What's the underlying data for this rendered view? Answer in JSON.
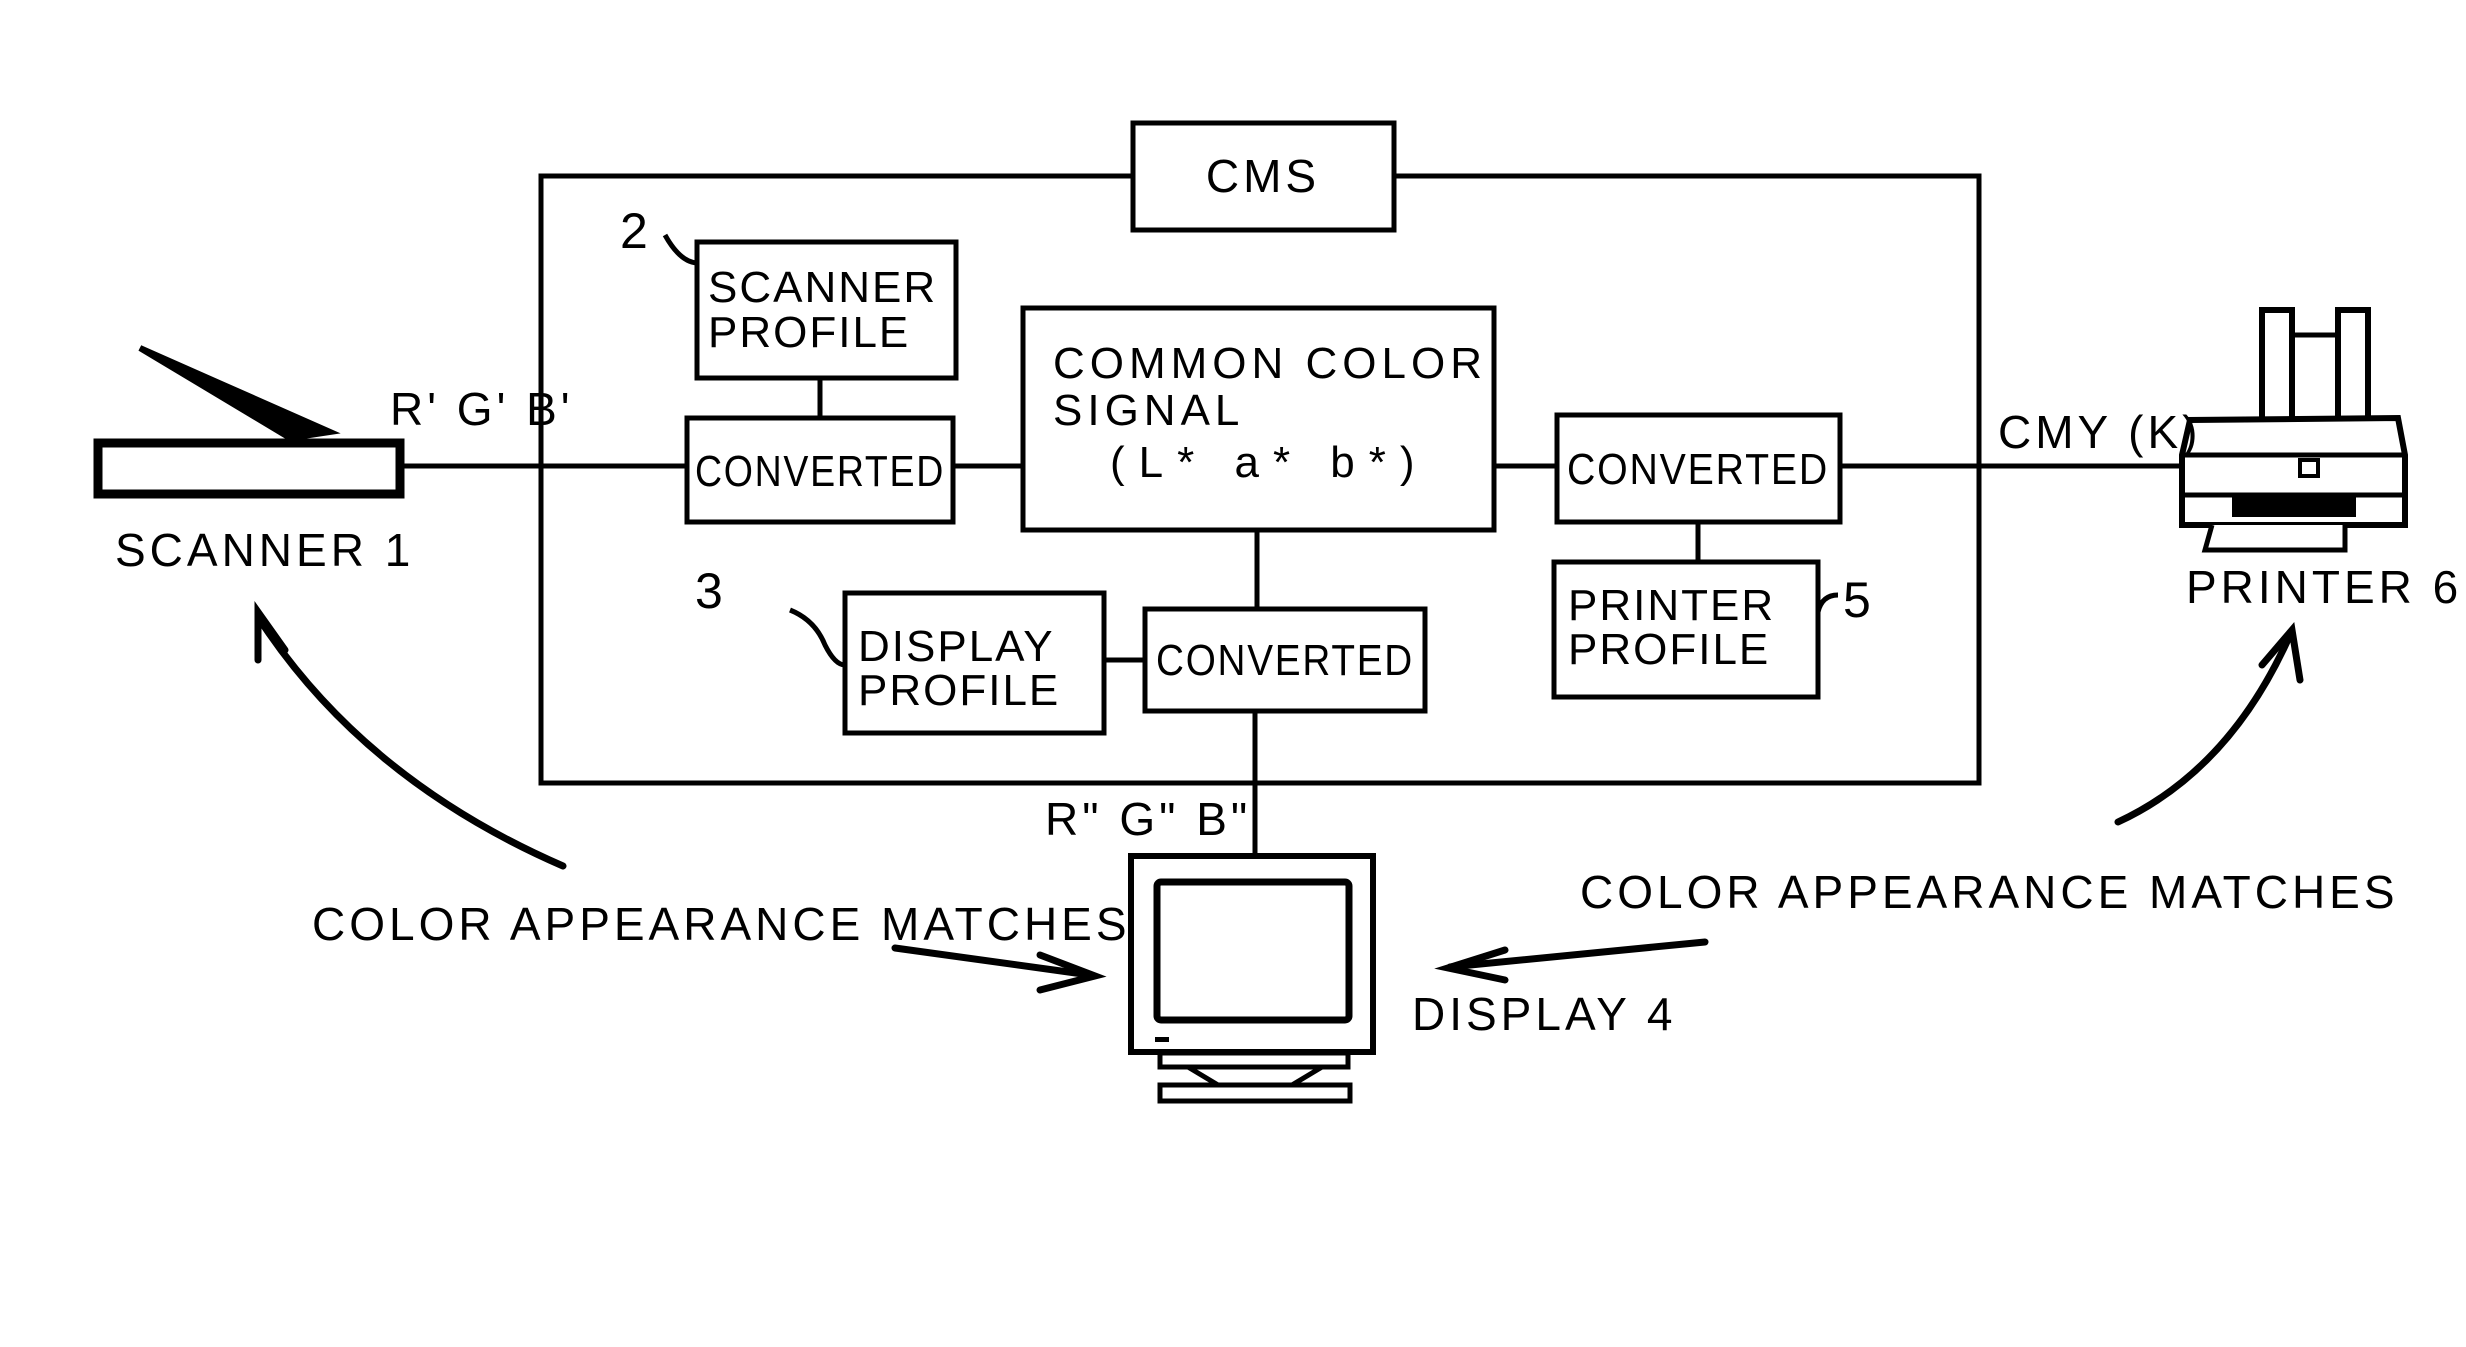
{
  "diagram": {
    "cms": {
      "label": "CMS"
    },
    "scanner": {
      "label": "SCANNER 1",
      "signal": "R' G' B'"
    },
    "printer": {
      "label": "PRINTER 6",
      "signal": "CMY (K)"
    },
    "display": {
      "label": "DISPLAY 4",
      "signal": "R\" G\" B\""
    },
    "common_signal": {
      "line1": "COMMON COLOR",
      "line2": "SIGNAL",
      "line3": "(L* a* b*)"
    },
    "scanner_profile": {
      "ref": "2",
      "line1": "SCANNER",
      "line2": "PROFILE"
    },
    "display_profile": {
      "ref": "3",
      "line1": "DISPLAY",
      "line2": "PROFILE"
    },
    "printer_profile": {
      "ref": "5",
      "line1": "PRINTER",
      "line2": "PROFILE"
    },
    "converters": [
      {
        "label": "CONVERTED"
      },
      {
        "label": "CONVERTED"
      },
      {
        "label": "CONVERTED"
      }
    ],
    "annotations": {
      "left": "COLOR APPEARANCE MATCHES",
      "right": "COLOR APPEARANCE MATCHES"
    }
  }
}
